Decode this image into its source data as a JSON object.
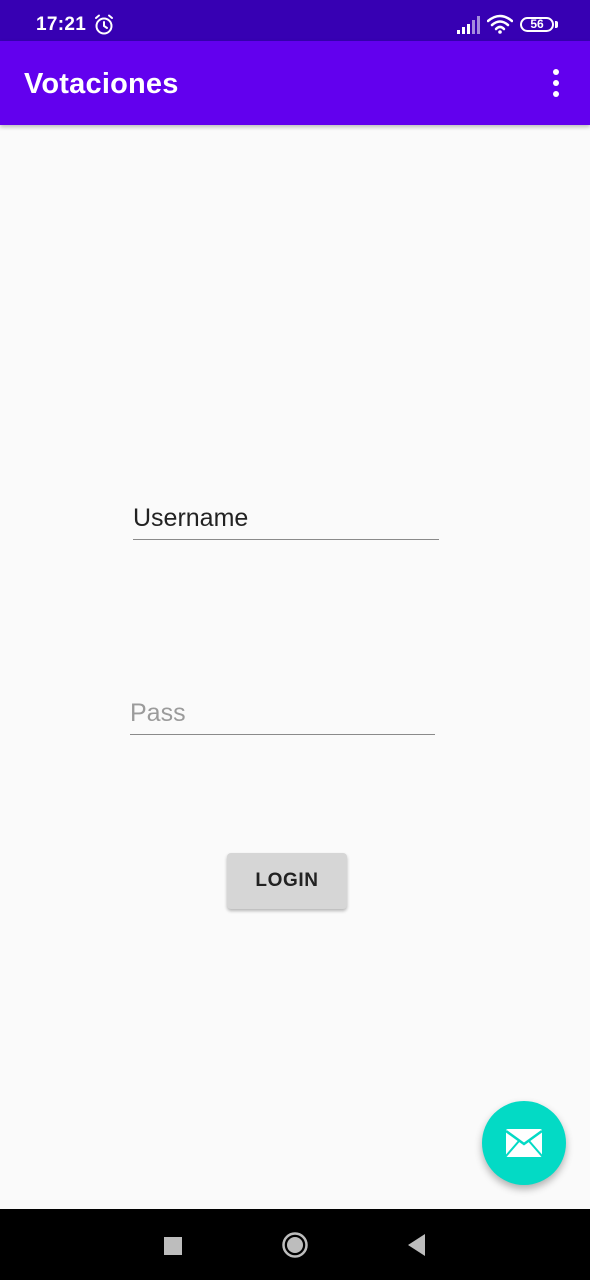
{
  "status_bar": {
    "time": "17:21",
    "battery_level": "56",
    "icons": [
      "alarm-icon",
      "signal-icon",
      "wifi-icon",
      "battery-icon"
    ]
  },
  "app_bar": {
    "title": "Votaciones",
    "menu_icon": "overflow-menu-icon"
  },
  "form": {
    "username_value": "Username",
    "pass_placeholder": "Pass",
    "login_label": "LOGIN"
  },
  "fab": {
    "icon": "mail-icon"
  },
  "nav_bar": {
    "icons": [
      "recent-apps-icon",
      "home-icon",
      "back-icon"
    ]
  },
  "colors": {
    "status_bar": "#3700b3",
    "app_bar": "#6200ee",
    "fab": "#03dac5",
    "background": "#fafafa",
    "button": "#d6d6d6"
  }
}
